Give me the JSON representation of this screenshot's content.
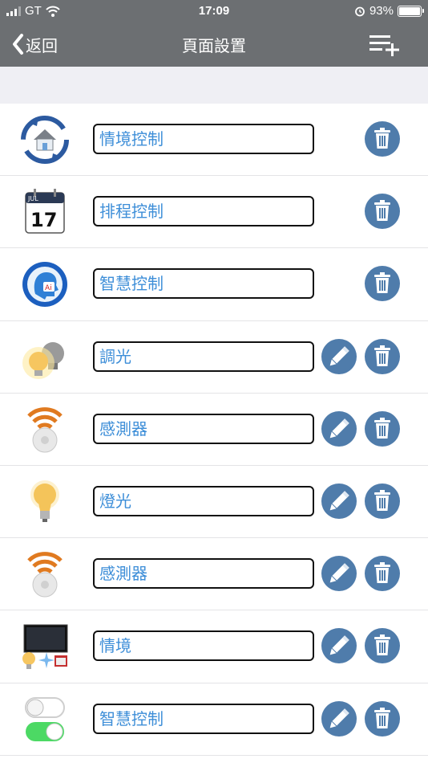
{
  "status_bar": {
    "carrier": "GT",
    "time": "17:09",
    "battery": "93%"
  },
  "nav": {
    "back_label": "返回",
    "title": "頁面設置"
  },
  "colors": {
    "nav_bg": "#6c6f72",
    "action_blue": "#4f7cab",
    "label_blue": "#3d8ed8"
  },
  "rows": [
    {
      "icon": "scene-house-icon",
      "label": "情境控制",
      "editable": false
    },
    {
      "icon": "calendar-icon",
      "label": "排程控制",
      "editable": false
    },
    {
      "icon": "ai-head-icon",
      "label": "智慧控制",
      "editable": false
    },
    {
      "icon": "dimmer-bulbs-icon",
      "label": "調光",
      "editable": true
    },
    {
      "icon": "sensor-icon",
      "label": "感測器",
      "editable": true
    },
    {
      "icon": "light-bulb-icon",
      "label": "燈光",
      "editable": true
    },
    {
      "icon": "sensor-icon",
      "label": "感測器",
      "editable": true
    },
    {
      "icon": "tv-scene-icon",
      "label": "情境",
      "editable": true
    },
    {
      "icon": "toggle-switches-icon",
      "label": "智慧控制",
      "editable": true
    }
  ],
  "calendar_icon": {
    "month": "JUL",
    "day": "17"
  },
  "ai_icon": {
    "text": "Ai"
  }
}
